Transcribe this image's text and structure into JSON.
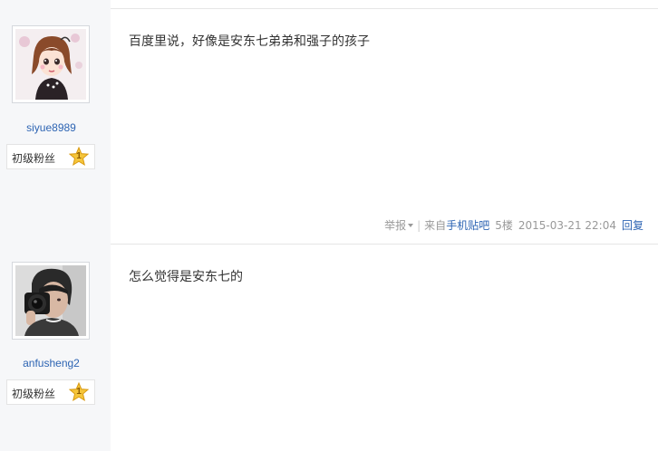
{
  "posts": [
    {
      "username": "siyue8989",
      "level": {
        "label": "初级粉丝",
        "number": "1"
      },
      "content": "百度里说，好像是安东七弟弟和强子的孩子",
      "meta": {
        "report": "举报",
        "from_prefix": "来自",
        "from_source": "手机贴吧",
        "floor": "5楼",
        "timestamp": "2015-03-21 22:04",
        "reply": "回复"
      }
    },
    {
      "username": "anfusheng2",
      "level": {
        "label": "初级粉丝",
        "number": "1"
      },
      "content": "怎么觉得是安东七的"
    }
  ],
  "colors": {
    "left_bg": "#f6f7f9",
    "link": "#2d64b3",
    "star": "#f5c53a"
  }
}
